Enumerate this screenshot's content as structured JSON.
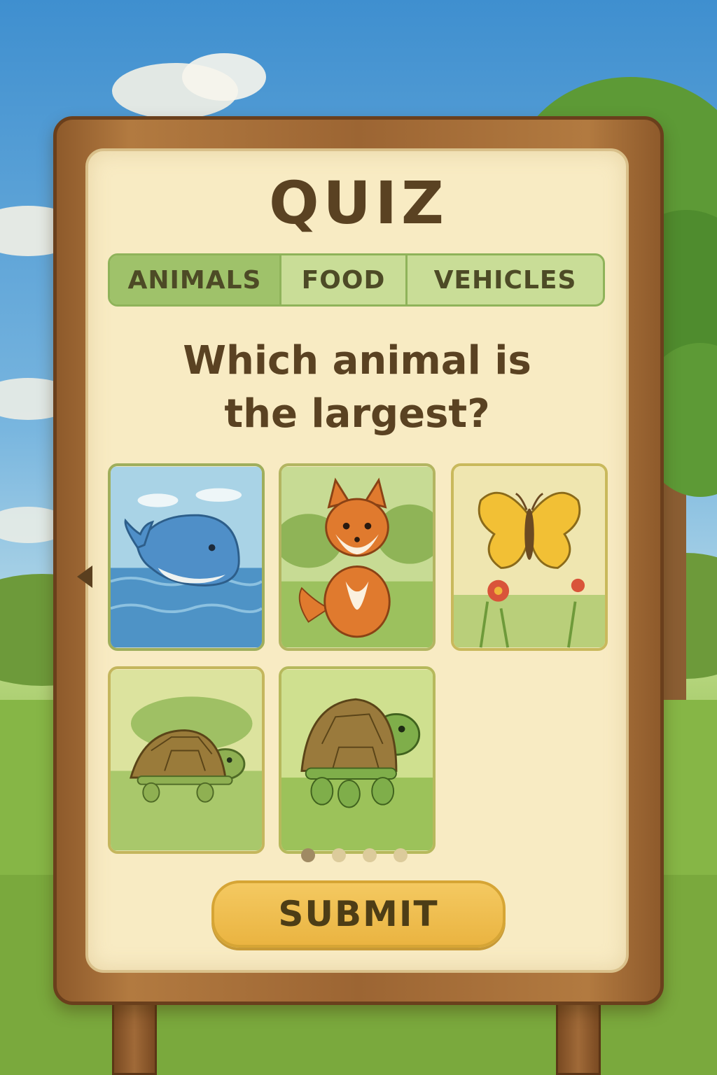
{
  "title": "QUIZ",
  "tabs": [
    {
      "label": "ANIMALS",
      "active": true
    },
    {
      "label": "FOOD",
      "active": false
    },
    {
      "label": "VEHICLES",
      "active": false
    }
  ],
  "question": {
    "line1": "Which animal is",
    "line2": "the largest?"
  },
  "answers": [
    {
      "icon": "whale-icon"
    },
    {
      "icon": "fox-icon"
    },
    {
      "icon": "butterfly-icon"
    },
    {
      "icon": "tortoise-icon"
    },
    {
      "icon": "turtle-icon"
    }
  ],
  "pagination": {
    "pages": 4,
    "current": 1
  },
  "submit_label": "SUBMIT",
  "colors": {
    "board": "#9c6533",
    "panel": "#f8ebc3",
    "tab_active": "#9fc26a",
    "tab_inactive": "#c9dd97",
    "submit": "#eab441",
    "text": "#5a4222"
  }
}
